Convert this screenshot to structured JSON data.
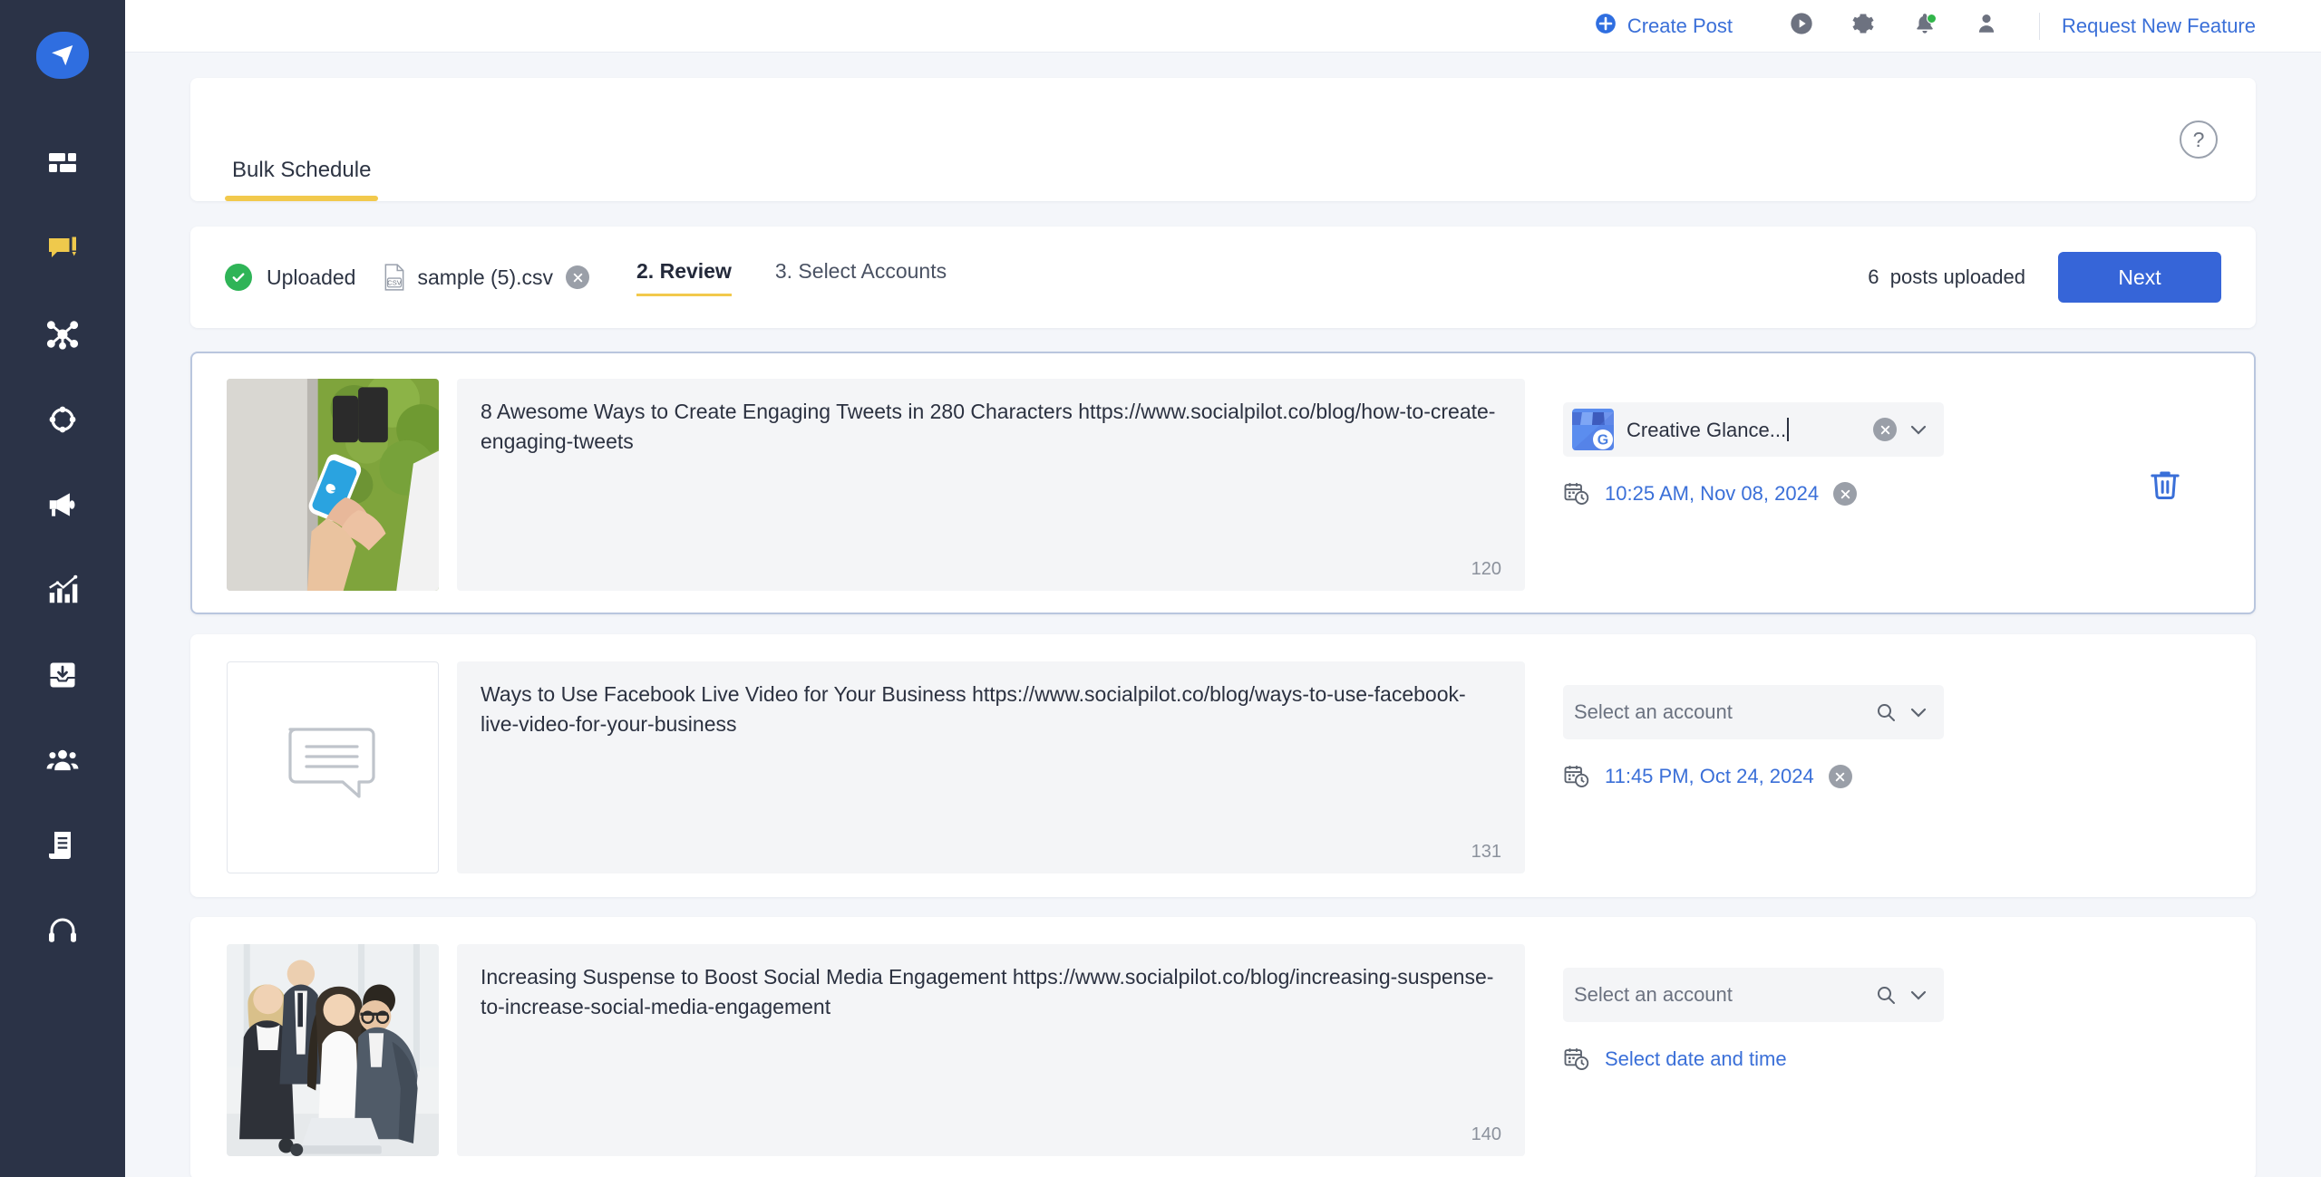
{
  "sidebar": {
    "logo": "paper-plane-logo",
    "items": [
      {
        "name": "dashboard",
        "icon": "dashboard-grid-icon"
      },
      {
        "name": "posts",
        "icon": "comment-compose-icon",
        "active": true
      },
      {
        "name": "network",
        "icon": "share-network-icon"
      },
      {
        "name": "campaigns",
        "icon": "circle-nodes-icon"
      },
      {
        "name": "promote",
        "icon": "megaphone-icon"
      },
      {
        "name": "analytics",
        "icon": "bar-chart-icon"
      },
      {
        "name": "inbox",
        "icon": "inbox-download-icon"
      },
      {
        "name": "team",
        "icon": "people-group-icon"
      },
      {
        "name": "reports",
        "icon": "document-icon"
      },
      {
        "name": "support",
        "icon": "headset-icon"
      }
    ]
  },
  "topbar": {
    "create_post": "Create Post",
    "create_post_icon": "plus-circle-icon",
    "play_icon": "play-circle-icon",
    "settings_icon": "gear-icon",
    "notifications_icon": "bell-icon",
    "profile_icon": "user-icon",
    "request_feature": "Request New Feature",
    "notification_dot_color": "#31b54a",
    "link_color": "#3a6fd8"
  },
  "page": {
    "tab_label": "Bulk Schedule",
    "tab_underline_color": "#f2c94c",
    "help_icon": "question-mark-icon",
    "help_label": "?"
  },
  "stepbar": {
    "uploaded_label": "Uploaded",
    "check_icon": "check-circle-icon",
    "file_icon": "csv-file-icon",
    "file_name": "sample (5).csv",
    "file_remove_icon": "close-circle-icon",
    "step_review": "2. Review",
    "step_accounts": "3. Select Accounts",
    "posts_count": "6",
    "posts_count_label": "posts uploaded",
    "next_button": "Next",
    "next_button_color": "#3665d8"
  },
  "posts": [
    {
      "active": true,
      "thumb_type": "photo-phone-twitter",
      "text": "8 Awesome Ways to Create Engaging Tweets in 280 Characters https://www.socialpilot.co/blog/how-to-create-engaging-tweets",
      "char_count": "120",
      "account_selected": true,
      "account_name": "Creative Glance...",
      "account_avatar": "google-business-profile-icon",
      "account_clear_icon": "close-circle-icon",
      "account_caret_icon": "chevron-down-icon",
      "date_icon": "calendar-clock-icon",
      "date_text": "10:25 AM, Nov 08, 2024",
      "date_clear_icon": "close-circle-icon",
      "has_delete": true,
      "delete_icon": "trash-icon"
    },
    {
      "active": false,
      "thumb_type": "placeholder-speech-bubble",
      "text": "Ways to Use Facebook Live Video for Your Business https://www.socialpilot.co/blog/ways-to-use-facebook-live-video-for-your-business",
      "char_count": "131",
      "account_selected": false,
      "account_placeholder": "Select an account",
      "account_search_icon": "search-icon",
      "account_caret_icon": "chevron-down-icon",
      "date_icon": "calendar-clock-icon",
      "date_text": "11:45 PM, Oct 24, 2024",
      "date_clear_icon": "close-circle-icon",
      "has_delete": false
    },
    {
      "active": false,
      "thumb_type": "photo-business-team",
      "text": "Increasing Suspense to Boost Social Media Engagement https://www.socialpilot.co/blog/increasing-suspense-to-increase-social-media-engagement",
      "char_count": "140",
      "account_selected": false,
      "account_placeholder": "Select an account",
      "account_search_icon": "search-icon",
      "account_caret_icon": "chevron-down-icon",
      "date_icon": "calendar-clock-icon",
      "date_text": "Select date and time",
      "has_delete": false
    }
  ]
}
